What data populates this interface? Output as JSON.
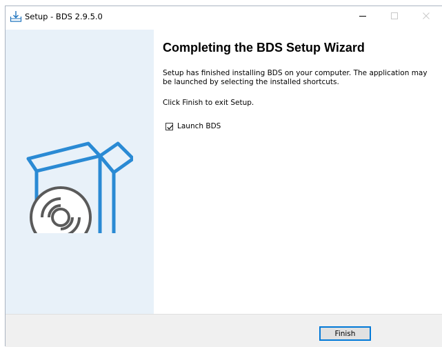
{
  "window": {
    "title": "Setup - BDS 2.9.5.0"
  },
  "titlebar_buttons": {
    "minimize_icon": "minimize-icon",
    "maximize_icon": "maximize-icon",
    "close_icon": "close-icon"
  },
  "content": {
    "heading": "Completing the BDS Setup Wizard",
    "paragraph_1": "Setup has finished installing BDS on your computer. The application may be launched by selecting the installed shortcuts.",
    "paragraph_2": "Click Finish to exit Setup.",
    "launch_checkbox": {
      "label": "Launch BDS",
      "checked": true
    }
  },
  "footer": {
    "finish_label": "Finish"
  },
  "colors": {
    "banner_bg": "#e8f1f9",
    "accent": "#0078d7",
    "icon_blue": "#2a8ad4",
    "footer_bg": "#f0f0f0"
  }
}
